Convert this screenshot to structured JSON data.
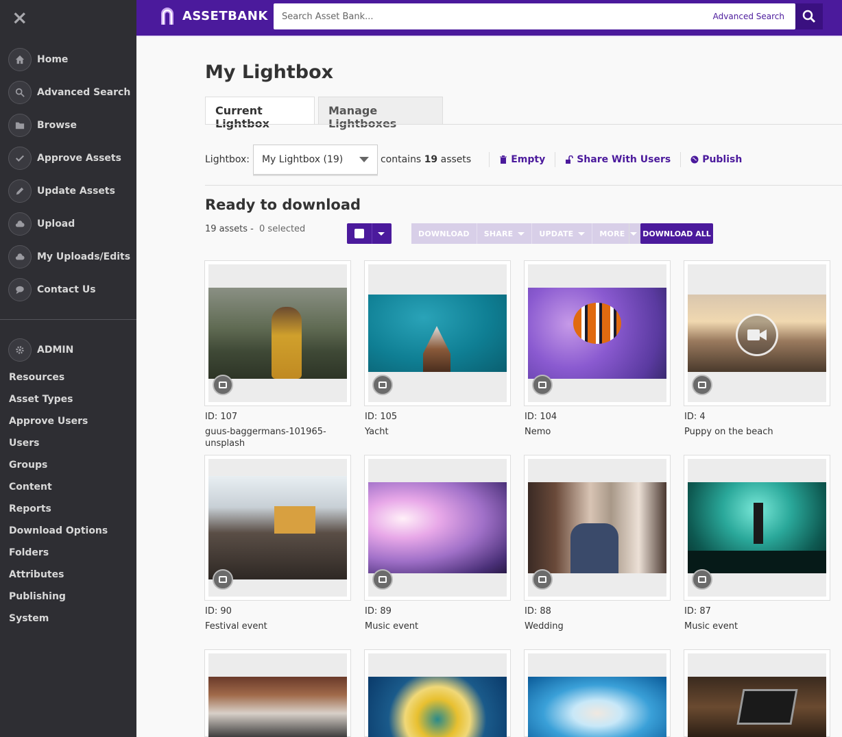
{
  "sidebar": {
    "nav": [
      {
        "label": "Home",
        "icon": "home-icon"
      },
      {
        "label": "Advanced Search",
        "icon": "search-icon"
      },
      {
        "label": "Browse",
        "icon": "folder-icon"
      },
      {
        "label": "Approve Assets",
        "icon": "check-icon"
      },
      {
        "label": "Update Assets",
        "icon": "pencil-icon"
      },
      {
        "label": "Upload",
        "icon": "cloud-upload-icon"
      },
      {
        "label": "My Uploads/Edits",
        "icon": "cloud-icon"
      },
      {
        "label": "Contact Us",
        "icon": "chat-icon"
      }
    ],
    "admin_label": "ADMIN",
    "admin_links": [
      "Resources",
      "Asset Types",
      "Approve Users",
      "Users",
      "Groups",
      "Content",
      "Reports",
      "Download Options",
      "Folders",
      "Attributes",
      "Publishing",
      "System"
    ]
  },
  "topbar": {
    "brand": "ASSETBANK",
    "search_placeholder": "Search Asset Bank...",
    "advanced_search": "Advanced Search"
  },
  "main": {
    "title": "My Lightbox",
    "tabs": [
      "Current Lightbox",
      "Manage Lightboxes"
    ],
    "lightbox_label": "Lightbox:",
    "lightbox_selected": "My Lightbox (19)",
    "contains_prefix": "contains",
    "contains_count": "19",
    "contains_suffix": "assets",
    "actions": {
      "empty": "Empty",
      "share": "Share With Users",
      "publish": "Publish"
    },
    "ready_title": "Ready to download",
    "assets_count": "19 assets -",
    "selected_count": "0 selected",
    "buttons": {
      "download": "DOWNLOAD",
      "share": "SHARE",
      "update": "UPDATE",
      "more": "MORE",
      "download_all": "DOWNLOAD ALL"
    }
  },
  "assets": [
    {
      "id": "ID: 107",
      "name": "guus-baggermans-101965-unsplash"
    },
    {
      "id": "ID: 105",
      "name": "Yacht"
    },
    {
      "id": "ID: 104",
      "name": "Nemo"
    },
    {
      "id": "ID: 4",
      "name": "Puppy on the beach"
    },
    {
      "id": "ID: 90",
      "name": "Festival event"
    },
    {
      "id": "ID: 89",
      "name": "Music event"
    },
    {
      "id": "ID: 88",
      "name": "Wedding"
    },
    {
      "id": "ID: 87",
      "name": "Music event"
    }
  ],
  "colors": {
    "brand": "#4b1a9c",
    "sidebar": "#2e2e33"
  }
}
